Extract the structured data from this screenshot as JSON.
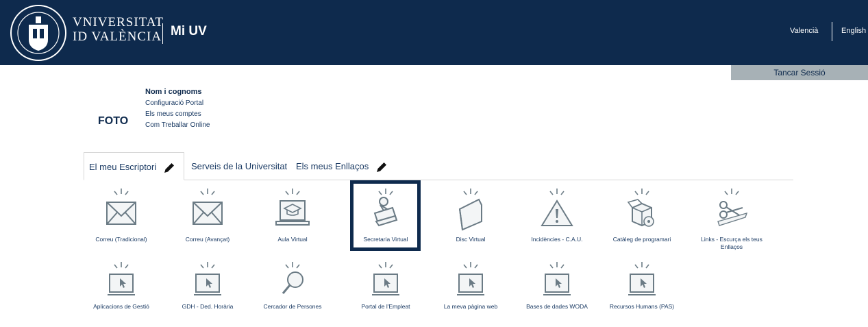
{
  "header": {
    "univ_line1": "VNIVERSITAT",
    "univ_line2": "ID VALÈNCIA",
    "app_title": "Mi UV",
    "lang_valencian": "Valencià",
    "lang_english": "English"
  },
  "session": {
    "logout_label": "Tancar Sessió"
  },
  "profile": {
    "photo_placeholder": "FOTO",
    "name": "Nom i cognoms",
    "links": [
      "Configuració Portal",
      "Els meus comptes",
      "Com Treballar Online"
    ]
  },
  "tabs": [
    {
      "label": "El meu Escriptori",
      "active": true
    },
    {
      "label": "Serveis de la Universitat",
      "active": false
    },
    {
      "label": "Els meus Enllaços",
      "active": false
    }
  ],
  "apps": [
    {
      "label": "Correu (Tradicional)",
      "icon": "envelope-icon"
    },
    {
      "label": "Correu (Avançat)",
      "icon": "envelope-icon"
    },
    {
      "label": "Aula Virtual",
      "icon": "laptop-graduation-icon"
    },
    {
      "label": "Secretaria Virtual",
      "icon": "stamp-icon",
      "selected": true
    },
    {
      "label": "Disc Virtual",
      "icon": "folder-icon"
    },
    {
      "label": "Incidències - C.A.U.",
      "icon": "warning-icon"
    },
    {
      "label": "Catàleg de programari",
      "icon": "software-box-icon"
    },
    {
      "label": "Links - Escurça els teus Enllaços",
      "icon": "scissors-icon"
    },
    {
      "label": "Aplicacions de Gestió",
      "icon": "monitor-cursor-icon"
    },
    {
      "label": "GDH - Ded. Horària",
      "icon": "monitor-cursor-icon"
    },
    {
      "label": "Cercador de Persones",
      "icon": "magnifier-icon"
    },
    {
      "label": "Portal de l'Empleat",
      "icon": "monitor-cursor-icon"
    },
    {
      "label": "La meva pàgina web",
      "icon": "monitor-cursor-icon"
    },
    {
      "label": "Bases de dades WODA",
      "icon": "monitor-cursor-icon"
    },
    {
      "label": "Recursos Humans (PAS)",
      "icon": "monitor-cursor-icon"
    }
  ],
  "colors": {
    "header_bg": "#0e2a4d",
    "logout_bg": "#a7b1b6",
    "link": "#1a3a63"
  }
}
